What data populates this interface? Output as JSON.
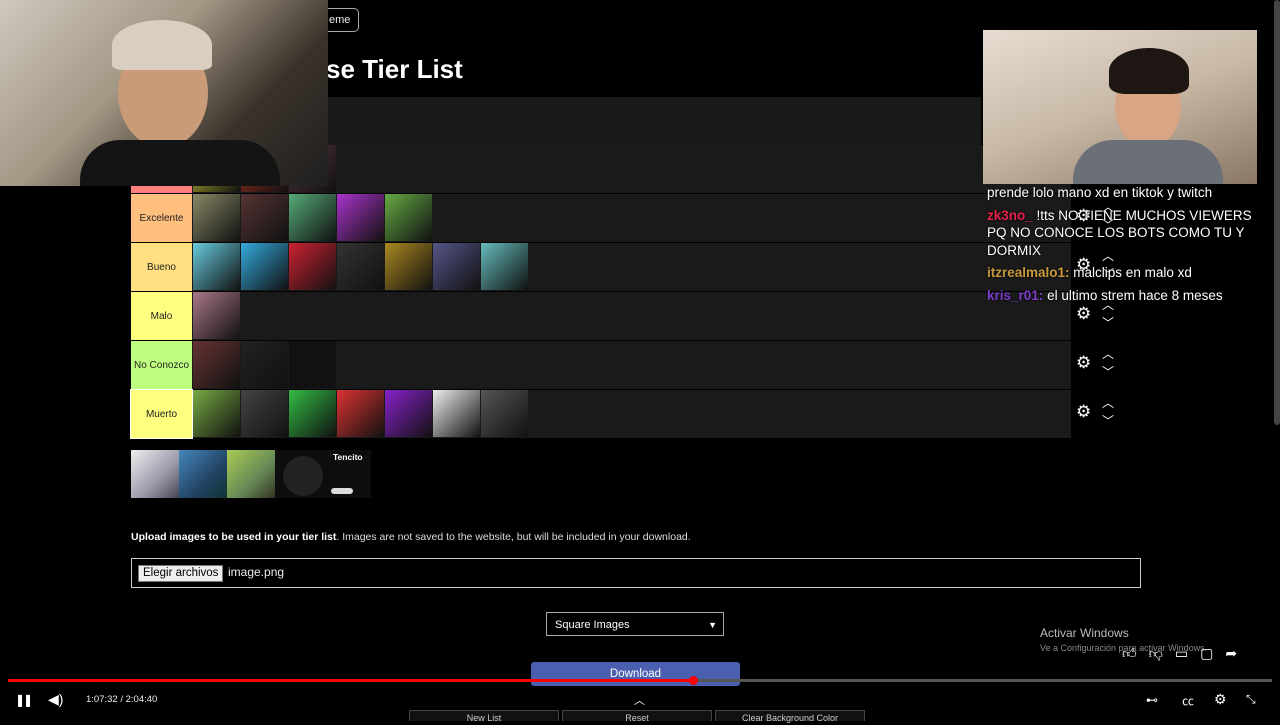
{
  "header": {
    "theme_label": "eme",
    "title": "se Tier List"
  },
  "tiers": [
    {
      "label": "",
      "color": "#ff7f7f",
      "thumbs": [
        "#cc3",
        "#a32",
        "#534"
      ]
    },
    {
      "label": "Excelente",
      "color": "#ffbf7f",
      "thumbs": [
        "#886",
        "#533",
        "#5a7",
        "#a3c",
        "#6a4"
      ]
    },
    {
      "label": "Bueno",
      "color": "#ffdf7f",
      "thumbs": [
        "#6cd",
        "#3ad",
        "#c23",
        "#333",
        "#a82",
        "#558",
        "#6bb"
      ]
    },
    {
      "label": "Malo",
      "color": "#ffff7f",
      "thumbs": [
        "#a78"
      ]
    },
    {
      "label": "No Conozco",
      "color": "#bfff7f",
      "thumbs": [
        "#633",
        "#222",
        "#111"
      ]
    },
    {
      "label": "Muerto",
      "color": "#ffff7f",
      "thumbs": [
        "#7a4",
        "#444",
        "#3b4",
        "#d33",
        "#82c",
        "#eee",
        "#555"
      ]
    }
  ],
  "pool": {
    "thumbs": [
      "#ccd",
      "#357",
      "#8a4",
      "#111"
    ],
    "card_title": "Tencito"
  },
  "upload": {
    "bold": "Upload images to be used in your tier list",
    "rest": ". Images are not saved to the website, but will be included in your download.",
    "button": "Elegir archivos",
    "filename": "image.png"
  },
  "select": {
    "value": "Square Images"
  },
  "download_label": "Download",
  "windows": {
    "title": "Activar Windows",
    "subtitle": "Ve a Configuración para activar Windows."
  },
  "chat": [
    {
      "user": "",
      "user_color": "#ffffff",
      "text": "prende lolo mano xd en tiktok y twitch"
    },
    {
      "user": "zk3no_",
      "user_color": "#e8204a",
      "text": "!tts NO TIENE MUCHOS VIEWERS PQ NO CONOCE LOS BOTS COMO TU Y DORMIX"
    },
    {
      "user": "itzrealmalo1:",
      "user_color": "#c99a3c",
      "text": "malclips en malo xd"
    },
    {
      "user": "kris_r01:",
      "user_color": "#7a3cc9",
      "text": "el ultimo strem hace 8 meses"
    }
  ],
  "player": {
    "time": "1:07:32 / 2:04:40",
    "progress": 0.542,
    "bottom_tabs": [
      "New List",
      "Reset",
      "Clear Background Color"
    ]
  }
}
